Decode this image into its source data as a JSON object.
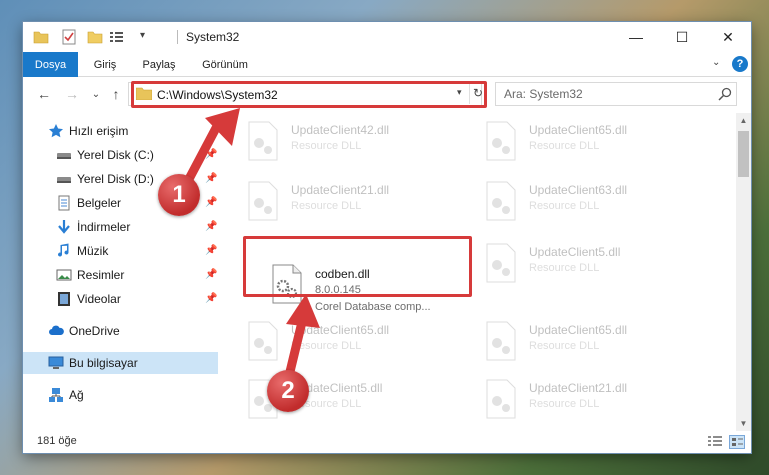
{
  "window": {
    "title": "System32"
  },
  "ribbon": {
    "tabs": [
      "Dosya",
      "Giriş",
      "Paylaş",
      "Görünüm"
    ],
    "active_tab": "Dosya",
    "help_label": "?"
  },
  "navbar": {
    "back": "←",
    "forward": "→",
    "recent": "⌄",
    "up": "↑",
    "address": "C:\\Windows\\System32",
    "refresh": "↻",
    "search_placeholder": "Ara: System32"
  },
  "sidebar": {
    "items": [
      {
        "label": "Hızlı erişim",
        "icon": "star-icon",
        "pinned": false
      },
      {
        "label": "Yerel Disk (C:)",
        "icon": "drive-icon",
        "pinned": true
      },
      {
        "label": "Yerel Disk (D:)",
        "icon": "drive-icon",
        "pinned": true
      },
      {
        "label": "Belgeler",
        "icon": "documents-icon",
        "pinned": true
      },
      {
        "label": "İndirmeler",
        "icon": "download-icon",
        "pinned": true
      },
      {
        "label": "Müzik",
        "icon": "music-icon",
        "pinned": true
      },
      {
        "label": "Resimler",
        "icon": "pictures-icon",
        "pinned": true
      },
      {
        "label": "Videolar",
        "icon": "videos-icon",
        "pinned": true
      },
      {
        "label": "OneDrive",
        "icon": "cloud-icon",
        "pinned": false
      },
      {
        "label": "Bu bilgisayar",
        "icon": "computer-icon",
        "pinned": false
      },
      {
        "label": "Ağ",
        "icon": "network-icon",
        "pinned": false
      }
    ],
    "selected": "Bu bilgisayar"
  },
  "files": {
    "left": [
      {
        "name": "UpdateClient42.dll",
        "desc": "Resource DLL"
      },
      {
        "name": "UpdateClient21.dll",
        "desc": "Resource DLL"
      },
      {
        "name": "codben.dll",
        "version": "8.0.0.145",
        "desc": "Corel Database comp..."
      },
      {
        "name": "UpdateClient65.dll",
        "desc": "Resource DLL"
      },
      {
        "name": "UpdateClient5.dll",
        "desc": "Resource DLL"
      }
    ],
    "right": [
      {
        "name": "UpdateClient65.dll",
        "desc": "Resource DLL"
      },
      {
        "name": "UpdateClient63.dll",
        "desc": "Resource DLL"
      },
      {
        "name": "UpdateClient5.dll",
        "desc": "Resource DLL"
      },
      {
        "name": "UpdateClient65.dll",
        "desc": "Resource DLL"
      },
      {
        "name": "UpdateClient21.dll",
        "desc": "Resource DLL"
      }
    ]
  },
  "status": {
    "item_count": "181 öğe"
  },
  "callouts": [
    "1",
    "2"
  ],
  "colors": {
    "accent": "#1979ca",
    "highlight": "#d63a3a",
    "selected_bg": "#cce4f7"
  }
}
